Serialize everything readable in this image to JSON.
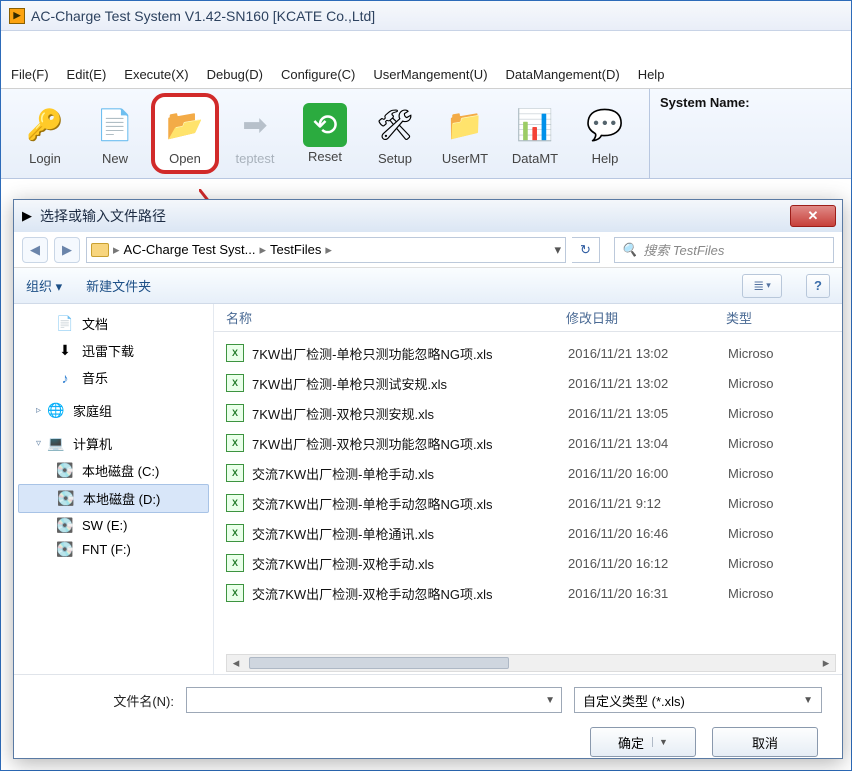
{
  "window": {
    "title": "AC-Charge Test System V1.42-SN160 [KCATE Co.,Ltd]"
  },
  "menu": {
    "file": "File(F)",
    "edit": "Edit(E)",
    "execute": "Execute(X)",
    "debug": "Debug(D)",
    "configure": "Configure(C)",
    "usermgmt": "UserMangement(U)",
    "datamgmt": "DataMangement(D)",
    "help": "Help"
  },
  "toolbar": {
    "login": "Login",
    "new": "New",
    "open": "Open",
    "steptest": "teptest",
    "reset": "Reset",
    "setup": "Setup",
    "usermt": "UserMT",
    "datamt": "DataMT",
    "help": "Help"
  },
  "sysname_label": "System Name:",
  "dialog": {
    "title": "选择或输入文件路径",
    "breadcrumb": {
      "a": "AC-Charge Test Syst...",
      "b": "TestFiles"
    },
    "search_placeholder": "搜索 TestFiles",
    "tb_organize": "组织 ▾",
    "tb_newfolder": "新建文件夹",
    "cols": {
      "name": "名称",
      "date": "修改日期",
      "type": "类型"
    },
    "nav": {
      "docs": "文档",
      "xunlei": "迅雷下载",
      "music": "音乐",
      "homegroup": "家庭组",
      "computer": "计算机",
      "drive_c": "本地磁盘 (C:)",
      "drive_d": "本地磁盘 (D:)",
      "drive_e": "SW (E:)",
      "drive_f": "FNT (F:)"
    },
    "files": [
      {
        "name": "7KW出厂检测-单枪只测功能忽略NG项.xls",
        "date": "2016/11/21 13:02",
        "type": "Microso"
      },
      {
        "name": "7KW出厂检测-单枪只测试安规.xls",
        "date": "2016/11/21 13:02",
        "type": "Microso"
      },
      {
        "name": "7KW出厂检测-双枪只测安规.xls",
        "date": "2016/11/21 13:05",
        "type": "Microso"
      },
      {
        "name": "7KW出厂检测-双枪只测功能忽略NG项.xls",
        "date": "2016/11/21 13:04",
        "type": "Microso"
      },
      {
        "name": "交流7KW出厂检测-单枪手动.xls",
        "date": "2016/11/20 16:00",
        "type": "Microso"
      },
      {
        "name": "交流7KW出厂检测-单枪手动忽略NG项.xls",
        "date": "2016/11/21 9:12",
        "type": "Microso"
      },
      {
        "name": "交流7KW出厂检测-单枪通讯.xls",
        "date": "2016/11/20 16:46",
        "type": "Microso"
      },
      {
        "name": "交流7KW出厂检测-双枪手动.xls",
        "date": "2016/11/20 16:12",
        "type": "Microso"
      },
      {
        "name": "交流7KW出厂检测-双枪手动忽略NG项.xls",
        "date": "2016/11/20 16:31",
        "type": "Microso"
      }
    ],
    "fn_label": "文件名(N):",
    "filetype": "自定义类型 (*.xls)",
    "ok": "确定",
    "cancel": "取消"
  }
}
